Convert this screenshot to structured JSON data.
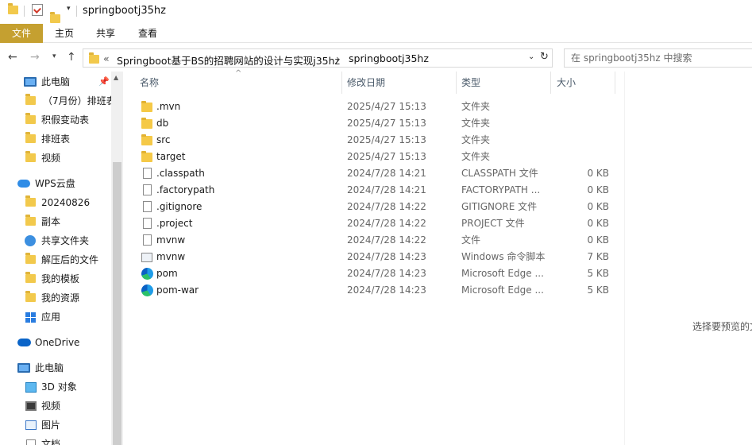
{
  "window": {
    "title": "springbootj35hz"
  },
  "ribbon": {
    "tabs": [
      "文件",
      "主页",
      "共享",
      "查看"
    ]
  },
  "address": {
    "prefix": "«",
    "crumbs": [
      "Springboot基于BS的招聘网站的设计与实现j35hz",
      "springbootj35hz"
    ],
    "separator": "›"
  },
  "search": {
    "placeholder": "在 springbootj35hz 中搜索"
  },
  "sidebar": {
    "items": [
      {
        "label": "此电脑",
        "icon": "pc-icon"
      },
      {
        "label": "（7月份）排班表",
        "icon": "folder-icon"
      },
      {
        "label": "积假变动表",
        "icon": "folder-icon"
      },
      {
        "label": "排班表",
        "icon": "folder-icon"
      },
      {
        "label": "视频",
        "icon": "folder-icon"
      },
      {
        "label": "WPS云盘",
        "icon": "cloud-icon"
      },
      {
        "label": "20240826",
        "icon": "folder-icon"
      },
      {
        "label": "副本",
        "icon": "folder-icon"
      },
      {
        "label": "共享文件夹",
        "icon": "share-icon"
      },
      {
        "label": "解压后的文件",
        "icon": "folder-icon"
      },
      {
        "label": "我的模板",
        "icon": "folder-icon"
      },
      {
        "label": "我的资源",
        "icon": "folder-icon"
      },
      {
        "label": "应用",
        "icon": "apps-icon"
      },
      {
        "label": "OneDrive",
        "icon": "onedrive-icon"
      },
      {
        "label": "此电脑",
        "icon": "pc-icon"
      },
      {
        "label": "3D 对象",
        "icon": "3d-objects-icon"
      },
      {
        "label": "视频",
        "icon": "video-icon"
      },
      {
        "label": "图片",
        "icon": "pictures-icon"
      },
      {
        "label": "文档",
        "icon": "documents-icon"
      }
    ]
  },
  "columns": [
    "名称",
    "修改日期",
    "类型",
    "大小"
  ],
  "files": [
    {
      "name": ".mvn",
      "date": "2025/4/27 15:13",
      "type": "文件夹",
      "size": "",
      "icon": "folder-icon"
    },
    {
      "name": "db",
      "date": "2025/4/27 15:13",
      "type": "文件夹",
      "size": "",
      "icon": "folder-icon"
    },
    {
      "name": "src",
      "date": "2025/4/27 15:13",
      "type": "文件夹",
      "size": "",
      "icon": "folder-icon"
    },
    {
      "name": "target",
      "date": "2025/4/27 15:13",
      "type": "文件夹",
      "size": "",
      "icon": "folder-icon"
    },
    {
      "name": ".classpath",
      "date": "2024/7/28 14:21",
      "type": "CLASSPATH 文件",
      "size": "0 KB",
      "icon": "file-icon"
    },
    {
      "name": ".factorypath",
      "date": "2024/7/28 14:21",
      "type": "FACTORYPATH ...",
      "size": "0 KB",
      "icon": "file-icon"
    },
    {
      "name": ".gitignore",
      "date": "2024/7/28 14:22",
      "type": "GITIGNORE 文件",
      "size": "0 KB",
      "icon": "file-icon"
    },
    {
      "name": ".project",
      "date": "2024/7/28 14:22",
      "type": "PROJECT 文件",
      "size": "0 KB",
      "icon": "file-icon"
    },
    {
      "name": "mvnw",
      "date": "2024/7/28 14:22",
      "type": "文件",
      "size": "0 KB",
      "icon": "file-icon"
    },
    {
      "name": "mvnw",
      "date": "2024/7/28 14:23",
      "type": "Windows 命令脚本",
      "size": "7 KB",
      "icon": "cmd-script-icon"
    },
    {
      "name": "pom",
      "date": "2024/7/28 14:23",
      "type": "Microsoft Edge ...",
      "size": "5 KB",
      "icon": "edge-icon"
    },
    {
      "name": "pom-war",
      "date": "2024/7/28 14:23",
      "type": "Microsoft Edge ...",
      "size": "5 KB",
      "icon": "edge-icon"
    }
  ],
  "preview": {
    "text": "选择要预览的文"
  }
}
